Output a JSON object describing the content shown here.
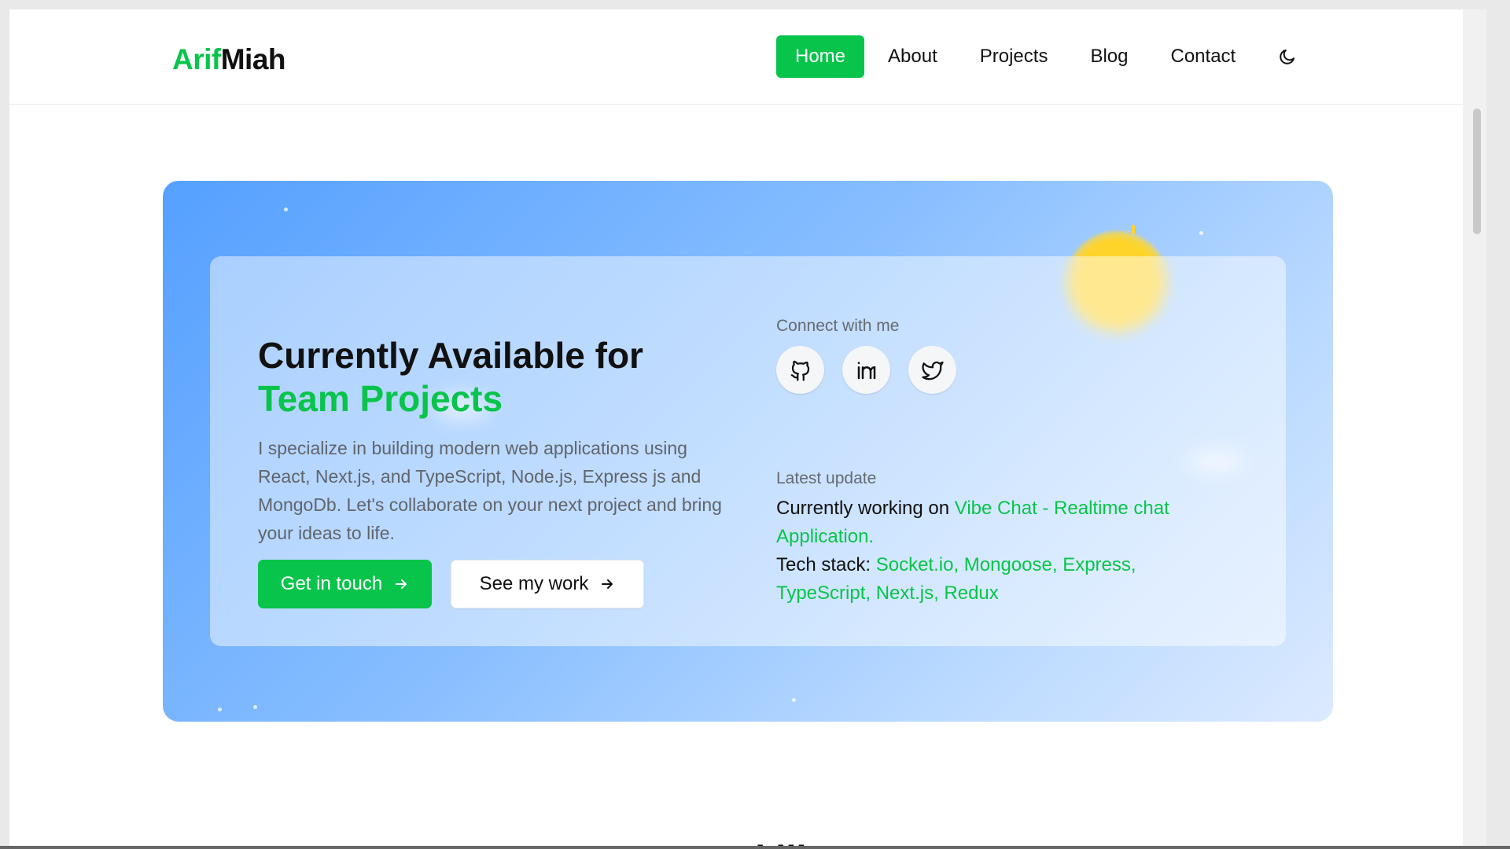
{
  "logo": {
    "first": "Arif",
    "last": "Miah"
  },
  "nav": {
    "items": [
      {
        "label": "Home"
      },
      {
        "label": "About"
      },
      {
        "label": "Projects"
      },
      {
        "label": "Blog"
      },
      {
        "label": "Contact"
      }
    ],
    "active": "Home",
    "theme_toggle_icon": "moon-icon"
  },
  "hero": {
    "headline_line1": "Currently Available for",
    "headline_line2": "Team Projects",
    "description": "I specialize in building modern web applications using React, Next.js, and TypeScript, Node.js, Express js and MongoDb. Let's collaborate on your next project and bring your ideas to life.",
    "primary_button": "Get in touch",
    "secondary_button": "See my work",
    "connect_label": "Connect with me",
    "social_icons": [
      "github-icon",
      "linkedin-icon",
      "twitter-icon"
    ],
    "latest_update_label": "Latest update",
    "working_prefix": "Currently working on",
    "working_project": "Vibe Chat - Realtime chat Application.",
    "tech_prefix": "Tech stack:",
    "tech_stack": "Socket.io, Mongoose, Express, TypeScript, Next.js, Redux"
  },
  "skills": {
    "title": "My Skills"
  },
  "colors": {
    "accent": "#08c44b",
    "text": "#111111",
    "muted": "#646b72",
    "hero_start": "#55a0ff",
    "hero_end": "#dceaff"
  }
}
